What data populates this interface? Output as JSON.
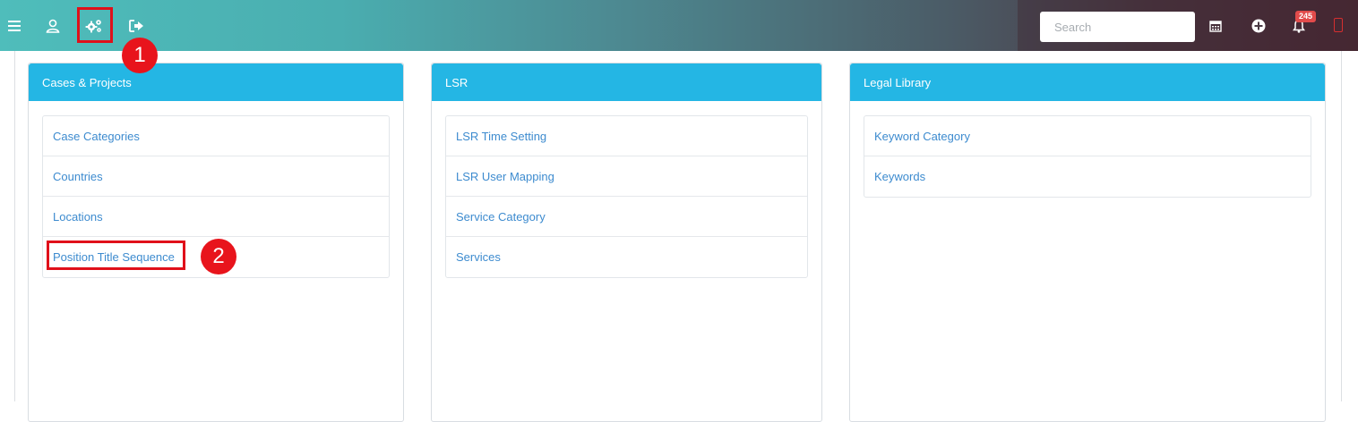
{
  "topbar": {
    "search_placeholder": "Search",
    "notification_count": "245",
    "icons": [
      "menu-icon",
      "user-icon",
      "settings-gears-icon",
      "logout-icon",
      "calendar-icon",
      "add-circle-icon",
      "bell-icon",
      "mobile-icon"
    ]
  },
  "panels": [
    {
      "title": "Cases & Projects",
      "items": [
        "Case Categories",
        "Countries",
        "Locations",
        "Position Title Sequence"
      ]
    },
    {
      "title": "LSR",
      "items": [
        "LSR Time Setting",
        "LSR User Mapping",
        "Service Category",
        "Services"
      ]
    },
    {
      "title": "Legal Library",
      "items": [
        "Keyword Category",
        "Keywords"
      ]
    }
  ],
  "annotations": {
    "step1": "1",
    "step2": "2"
  },
  "colors": {
    "panel_header": "#24b6e4",
    "link": "#3d8bcf",
    "highlight": "#e0101a"
  }
}
